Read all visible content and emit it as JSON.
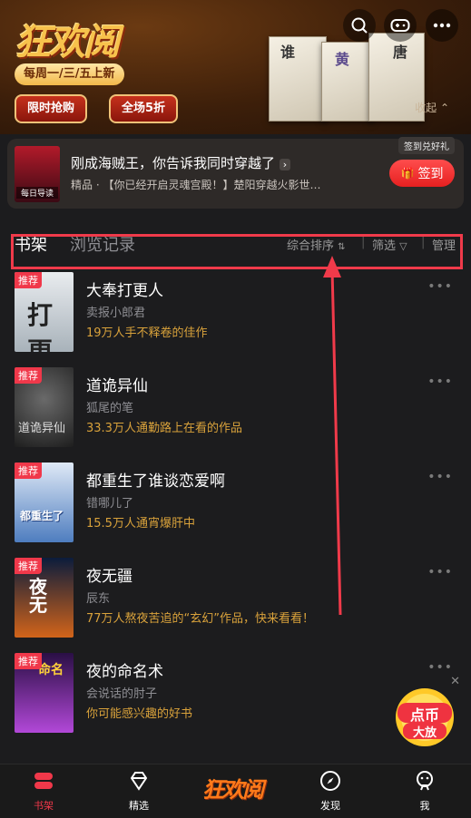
{
  "banner": {
    "logo": "狂欢阅",
    "schedule": "每周一/三/五上新",
    "flash_sale": "限时抢购",
    "half_off": "全场5折",
    "collapse": "收起"
  },
  "promo_card": {
    "title": "刚成海贼王，你告诉我同时穿越了",
    "subtitle": "精品 · 【你已经开启灵魂宫殿！】楚阳穿越火影世…",
    "badge": "签到兑好礼",
    "signin_label": "签到",
    "cover_caption": "每日导读"
  },
  "tabs": {
    "bookshelf": "书架",
    "history": "浏览记录",
    "sort": "综合排序",
    "filter": "筛选",
    "manage": "管理"
  },
  "books": [
    {
      "tag": "推荐",
      "title": "大奉打更人",
      "author": "卖报小郎君",
      "desc": "19万人手不释卷的佳作"
    },
    {
      "tag": "推荐",
      "title": "道诡异仙",
      "author": "狐尾的笔",
      "desc": "33.3万人通勤路上在看的作品"
    },
    {
      "tag": "推荐",
      "title": "都重生了谁谈恋爱啊",
      "author": "错哪儿了",
      "desc": "15.5万人通宵爆肝中"
    },
    {
      "tag": "推荐",
      "title": "夜无疆",
      "author": "辰东",
      "desc": "77万人熬夜苦追的“玄幻”作品，快来看看！"
    },
    {
      "tag": "推荐",
      "title": "夜的命名术",
      "author": "会说话的肘子",
      "desc": "你可能感兴趣的好书"
    }
  ],
  "floating": {
    "line1": "点币",
    "line2": "大放"
  },
  "bottom_nav": [
    {
      "label": "书架",
      "icon": "bookshelf-icon"
    },
    {
      "label": "精选",
      "icon": "diamond-icon"
    },
    {
      "label": "狂欢阅",
      "icon": "carnival-logo"
    },
    {
      "label": "发现",
      "icon": "compass-icon"
    },
    {
      "label": "我",
      "icon": "profile-icon"
    }
  ],
  "colors": {
    "accent": "#f0384a",
    "gold": "#d9a23b",
    "background": "#1c1c1e"
  }
}
